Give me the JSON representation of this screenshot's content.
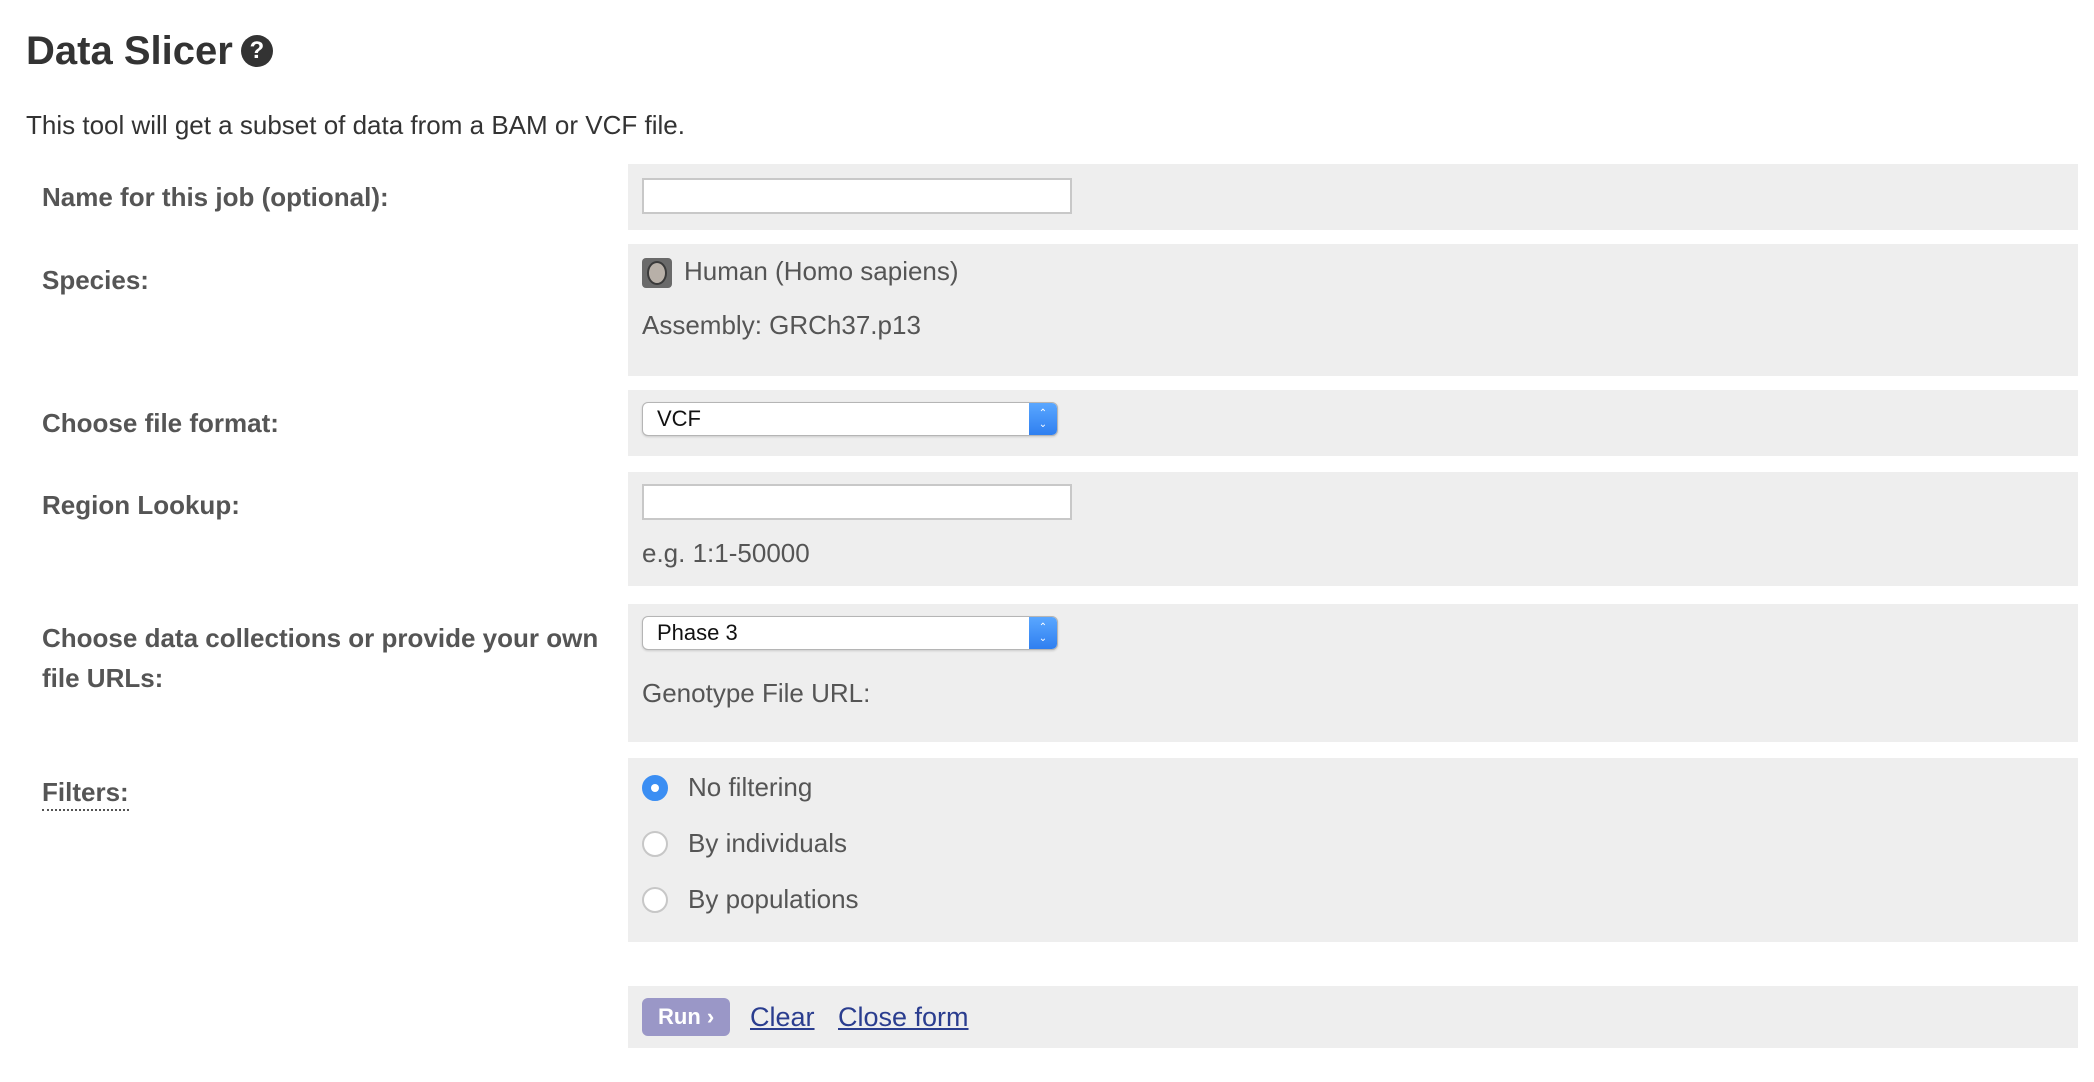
{
  "header": {
    "title": "Data Slicer",
    "help_icon": "question-circle-icon",
    "intro": "This tool will get a subset of data from a BAM or VCF file."
  },
  "form": {
    "job_name": {
      "label": "Name for this job (optional):",
      "value": ""
    },
    "species": {
      "label": "Species:",
      "name": "Human (Homo sapiens)",
      "assembly": "Assembly: GRCh37.p13",
      "icon": "human-species-icon"
    },
    "file_format": {
      "label": "Choose file format:",
      "selected": "VCF"
    },
    "region": {
      "label": "Region Lookup:",
      "value": "",
      "hint": "e.g. 1:1-50000"
    },
    "collections": {
      "label": "Choose data collections or provide your own file URLs:",
      "selected": "Phase 3",
      "genotype_label": "Genotype File URL:"
    },
    "filters": {
      "label": "Filters:",
      "options": [
        "No filtering",
        "By individuals",
        "By populations"
      ],
      "selected_index": 0
    },
    "actions": {
      "run": "Run ›",
      "clear": "Clear",
      "close": "Close form"
    }
  },
  "colors": {
    "field_bg": "#eeeeee",
    "radio_checked": "#3b8ef3",
    "run_button": "#9a97c7",
    "link": "#2a3d8f"
  }
}
